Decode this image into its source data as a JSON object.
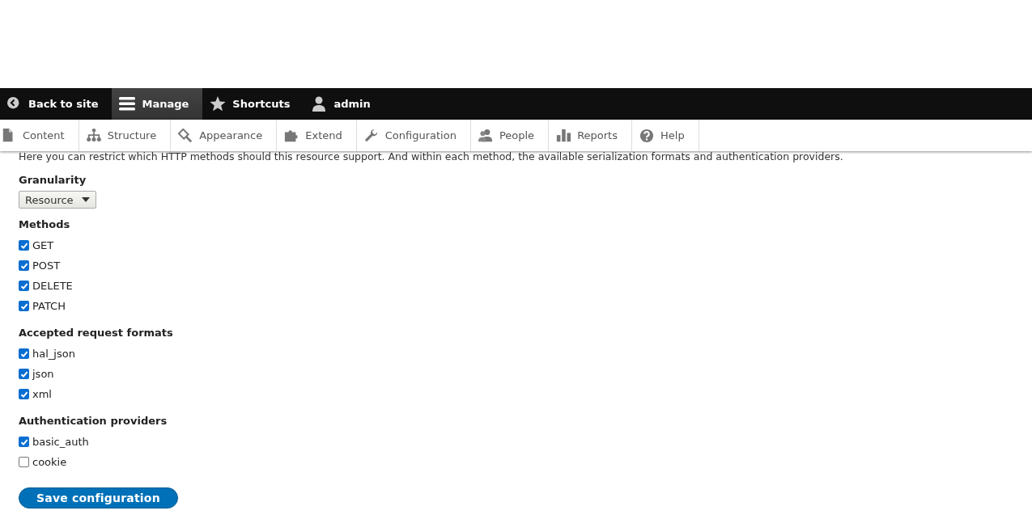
{
  "toolbar": {
    "items": [
      {
        "label": "Back to site",
        "selected": false
      },
      {
        "label": "Manage",
        "selected": true
      },
      {
        "label": "Shortcuts",
        "selected": false
      },
      {
        "label": "admin",
        "selected": false
      }
    ]
  },
  "tray": {
    "items": [
      {
        "label": "Content"
      },
      {
        "label": "Structure"
      },
      {
        "label": "Appearance"
      },
      {
        "label": "Extend"
      },
      {
        "label": "Configuration"
      },
      {
        "label": "People"
      },
      {
        "label": "Reports"
      },
      {
        "label": "Help"
      }
    ]
  },
  "form": {
    "description": "Here you can restrict which HTTP methods should this resource support. And within each method, the available serialization formats and authentication providers.",
    "granularity": {
      "label": "Granularity",
      "value": "Resource"
    },
    "groups": [
      {
        "title": "Methods",
        "options": [
          {
            "label": "GET",
            "checked": true
          },
          {
            "label": "POST",
            "checked": true
          },
          {
            "label": "DELETE",
            "checked": true
          },
          {
            "label": "PATCH",
            "checked": true
          }
        ]
      },
      {
        "title": "Accepted request formats",
        "options": [
          {
            "label": "hal_json",
            "checked": true
          },
          {
            "label": "json",
            "checked": true
          },
          {
            "label": "xml",
            "checked": true
          }
        ]
      },
      {
        "title": "Authentication providers",
        "options": [
          {
            "label": "basic_auth",
            "checked": true
          },
          {
            "label": "cookie",
            "checked": false
          }
        ]
      }
    ],
    "submit": "Save configuration"
  }
}
